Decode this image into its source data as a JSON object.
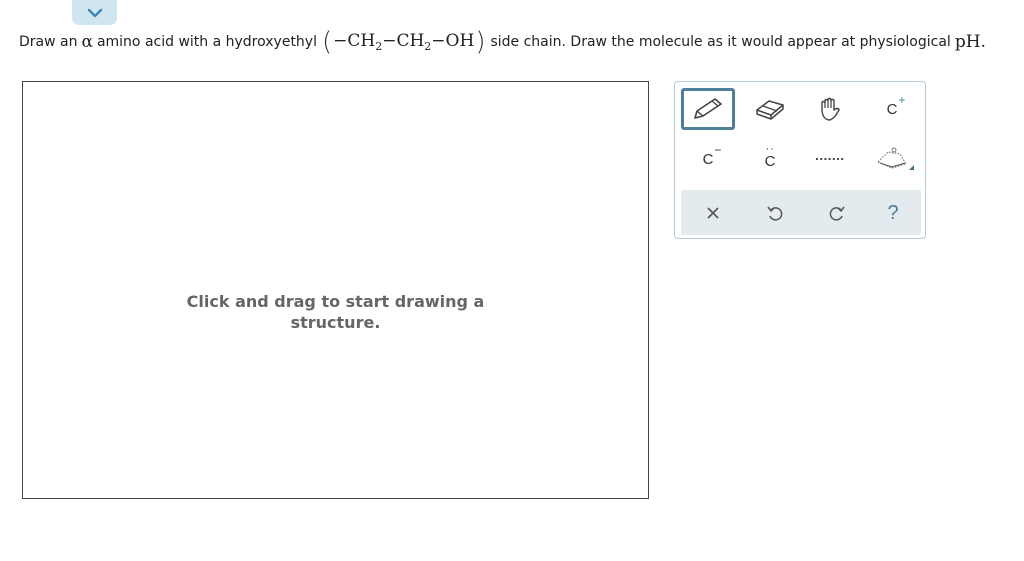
{
  "prompt": {
    "before": "Draw an",
    "alpha": "α",
    "middle": "amino acid with a hydroxyethyl",
    "formula": {
      "dash1": "−CH",
      "sub1": "2",
      "dash2": "−CH",
      "sub2": "2",
      "dash3": "−OH"
    },
    "after": "side chain. Draw the molecule as it would appear at physiological",
    "ph": "pH."
  },
  "canvas": {
    "hint_line1": "Click and drag to start drawing a",
    "hint_line2": "structure."
  },
  "palette": {
    "anion_atom": "C",
    "anion_charge": "−",
    "lonepair_atom": "C",
    "cation_atom": "C",
    "cation_charge": "+",
    "help_label": "?"
  },
  "colors": {
    "accent": "#4e8099",
    "collapse_tab": "#cfe6f1",
    "action_bar": "#e4ebef"
  },
  "icons": [
    "chevron-down-icon",
    "pencil-icon",
    "eraser-icon",
    "hand-icon",
    "cation-icon",
    "anion-icon",
    "lone-pair-icon",
    "dotted-bond-icon",
    "ring-template-icon",
    "close-icon",
    "undo-icon",
    "redo-icon",
    "help-icon"
  ]
}
